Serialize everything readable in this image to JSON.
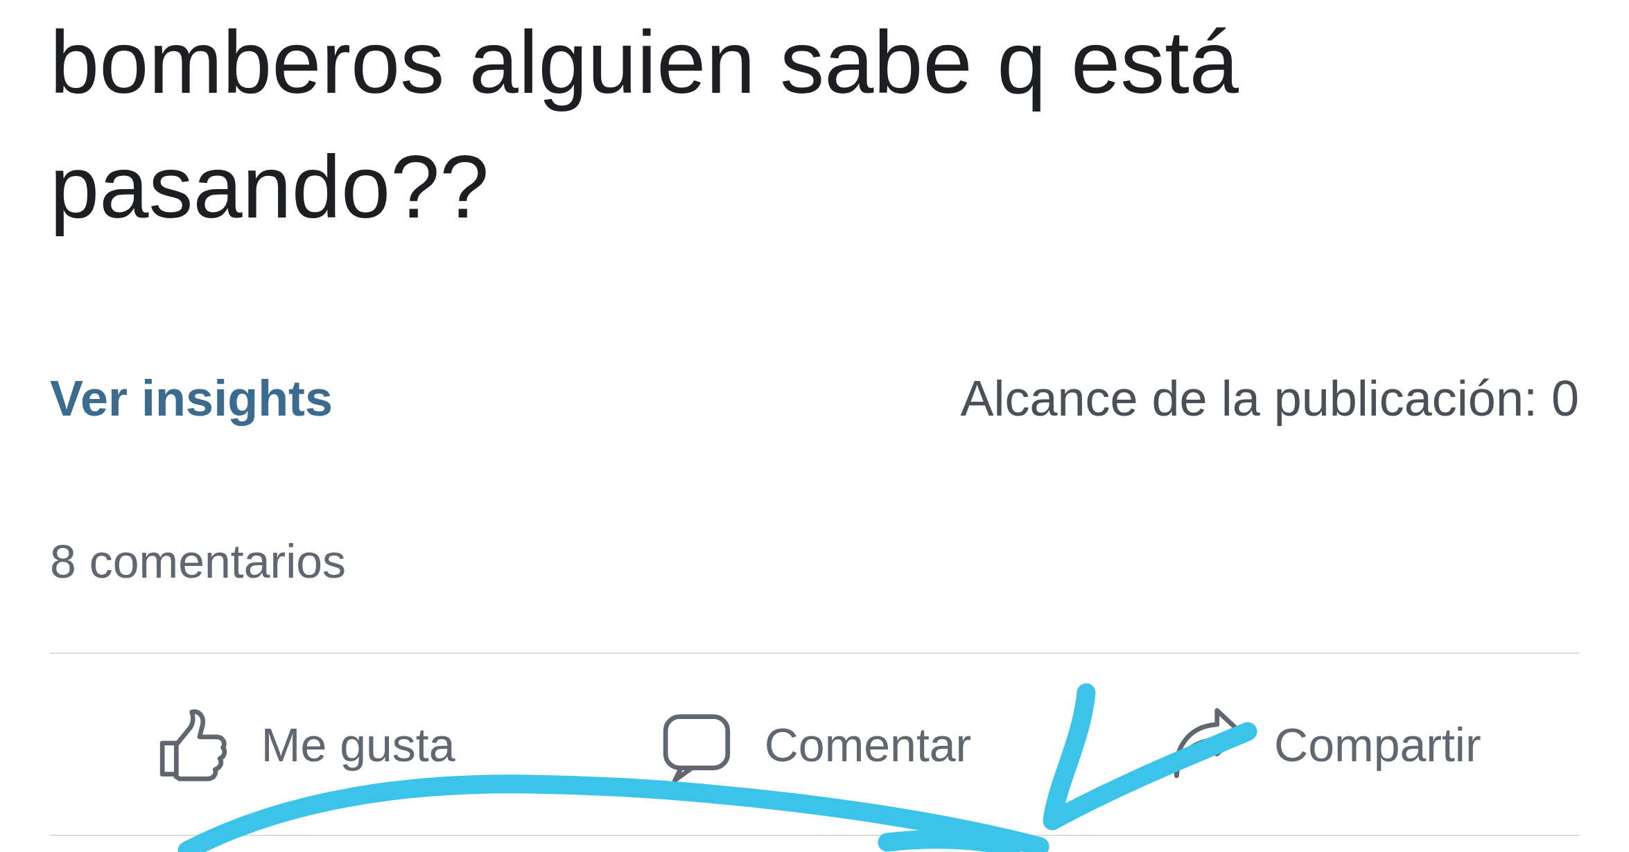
{
  "post": {
    "text": "bomberos alguien sabe q está pasando??",
    "insights_link": "Ver insights",
    "reach": "Alcance de la publicación: 0",
    "comments_count": "8 comentarios"
  },
  "actions": [
    {
      "kind": "like",
      "label": "Me gusta"
    },
    {
      "kind": "comment",
      "label": "Comentar"
    },
    {
      "kind": "share",
      "label": "Compartir"
    }
  ]
}
